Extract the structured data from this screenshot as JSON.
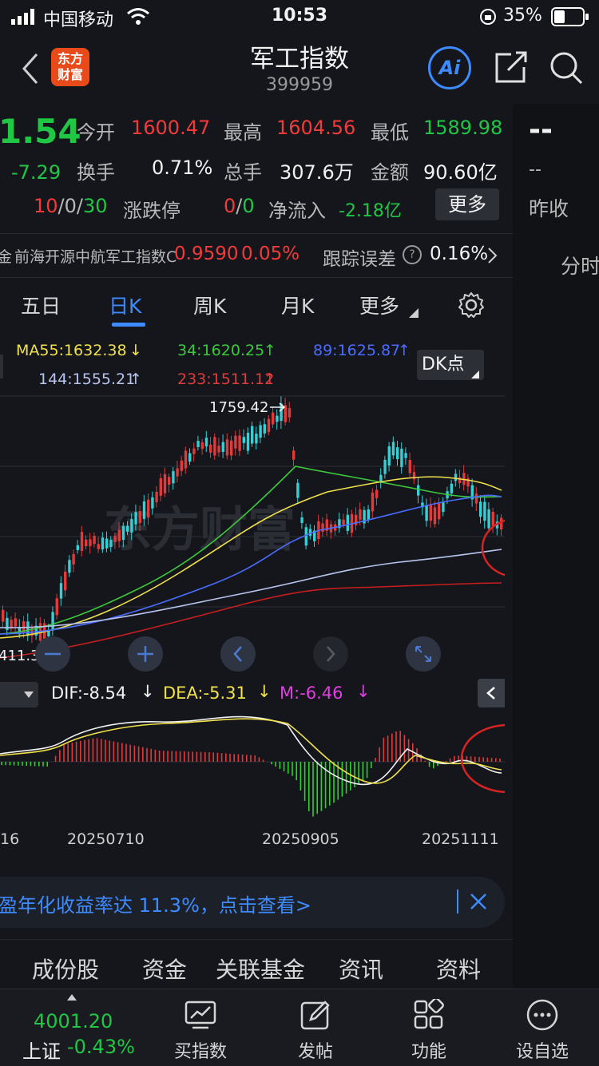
{
  "status_bar": {
    "carrier": "中国移动",
    "time": "10:53",
    "battery": "35%"
  },
  "header": {
    "title": "军工指数",
    "code": "399959",
    "logo_line1": "东方",
    "logo_line2": "财富",
    "ai_label": "Ai"
  },
  "quote": {
    "price": "1.54",
    "change": "-7.29",
    "open_label": "今开",
    "open": "1600.47",
    "high_label": "最高",
    "high": "1604.56",
    "low_label": "最低",
    "low": "1589.98",
    "turnover_label": "换手",
    "turnover": "0.71%",
    "volume_label": "总手",
    "volume": "307.6万",
    "amount_label": "金额",
    "amount": "90.60亿",
    "updown_a": "10",
    "updown_sep1": "/",
    "updown_b": "0",
    "updown_sep2": "/",
    "updown_c": "30",
    "limit_label": "涨跌停",
    "limit_a": "0",
    "limit_sep": "/",
    "limit_b": "0",
    "inflow_label": "净流入",
    "inflow": "-2.18亿",
    "more_button": "更多"
  },
  "right_panel": {
    "dash1": "--",
    "dash2": "--",
    "prev_close_label": "昨收",
    "timeshare_label": "分时"
  },
  "fund_row": {
    "prefix": "金",
    "name": "前海开源中航军工指数C",
    "nav": "0.9590",
    "pct": "0.05%",
    "tracking_label": "跟踪误差",
    "tracking_value": "0.16%"
  },
  "tabs": [
    {
      "label": "五日"
    },
    {
      "label": "日K"
    },
    {
      "label": "周K"
    },
    {
      "label": "月K"
    },
    {
      "label": "更多"
    }
  ],
  "ma": {
    "ma55": "MA55:1632.38",
    "ma34": "34:1620.25",
    "ma89": "89:1625.87",
    "ma144": "144:1555.21",
    "ma233": "233:1511.12",
    "dk_label": "DK点"
  },
  "chart_annotations": {
    "high_label": "1759.42",
    "low_label": "411.37",
    "watermark": "东方财富"
  },
  "macd": {
    "dif": "DIF:-8.54",
    "dea": "DEA:-5.31",
    "m": "M:-6.46",
    "dif_arrow": "↓",
    "dea_arrow": "↓",
    "m_arrow": "↓"
  },
  "dates": {
    "d0": "16",
    "d1": "20250710",
    "d2": "20250905",
    "d3": "20251111"
  },
  "banner": {
    "text": "盈年化收益率达 11.3%，点击查看>"
  },
  "bottom_tabs": [
    {
      "label": "成份股"
    },
    {
      "label": "资金"
    },
    {
      "label": "关联基金"
    },
    {
      "label": "资讯"
    },
    {
      "label": "资料"
    }
  ],
  "tabbar": {
    "index_value": "4001.20",
    "index_name": "上证",
    "index_change": "-0.43%",
    "items": [
      {
        "label": "买指数"
      },
      {
        "label": "发帖"
      },
      {
        "label": "功能"
      },
      {
        "label": "设自选"
      }
    ]
  },
  "colors": {
    "up": "#f23a3a",
    "down": "#1fc744",
    "accent": "#3d8bff",
    "bg": "#14161c"
  }
}
